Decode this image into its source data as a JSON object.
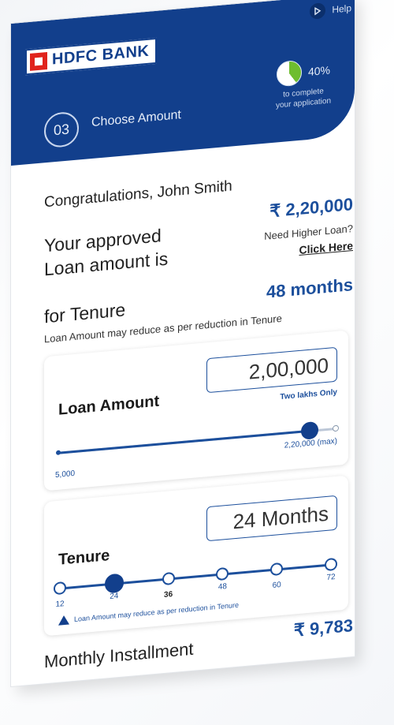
{
  "header": {
    "help_label": "Help",
    "bank_name": "HDFC BANK",
    "step_number": "03",
    "step_label": "Choose Amount",
    "progress_percent": "40%",
    "progress_value": 0.4,
    "progress_note_line1": "to complete",
    "progress_note_line2": "your application"
  },
  "summary": {
    "greeting": "Congratulations, John Smith",
    "approved_line1": "Your approved",
    "approved_line2": "Loan amount is",
    "approved_amount": "₹ 2,20,000",
    "higher_loan_question": "Need Higher Loan?",
    "click_here": "Click Here",
    "tenure_label": "for Tenure",
    "tenure_months": "48 months",
    "reduction_note": "Loan Amount may reduce as per reduction in Tenure"
  },
  "loan_card": {
    "title": "Loan Amount",
    "value": "2,00,000",
    "value_in_words": "Two lakhs Only",
    "min_label": "5,000",
    "max_label": "2,20,000 (max)",
    "min": 5000,
    "max": 220000,
    "current": 200000
  },
  "tenure_card": {
    "title": "Tenure",
    "value": "24 Months",
    "ticks": [
      "12",
      "24",
      "36",
      "48",
      "60",
      "72"
    ],
    "selected_index": 1,
    "warning": "Loan Amount may reduce as per reduction in Tenure"
  },
  "emi": {
    "label": "Monthly Installment",
    "value": "₹ 9,783"
  },
  "colors": {
    "brand_blue": "#123f8c",
    "accent_blue": "#1c4f9c",
    "progress_green": "#6ebd2f",
    "logo_red": "#e0231c"
  }
}
